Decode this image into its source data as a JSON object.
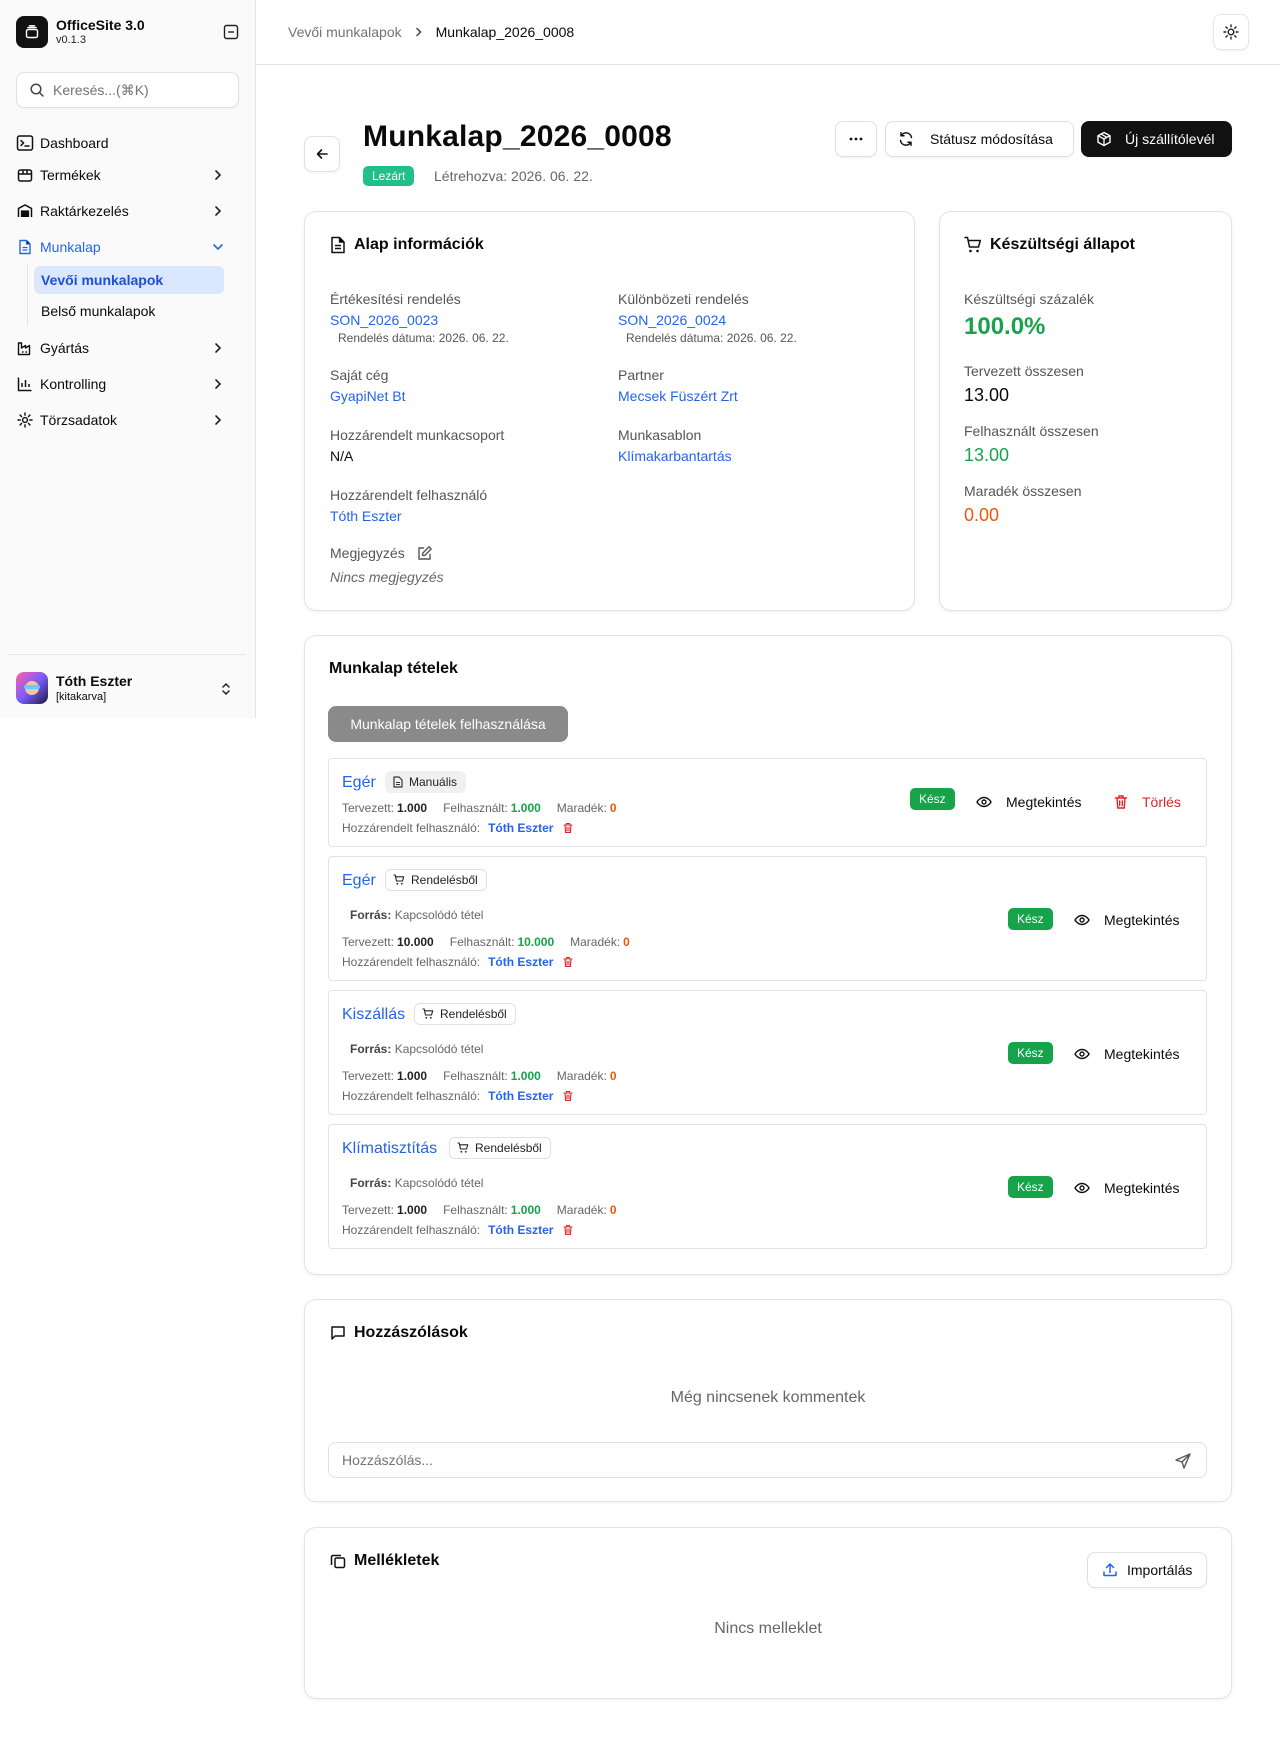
{
  "app": {
    "name": "OfficeSite 3.0",
    "version": "v0.1.3"
  },
  "sidebar": {
    "search_placeholder": "Keresés...(⌘K)",
    "items": [
      {
        "label": "Dashboard"
      },
      {
        "label": "Termékek"
      },
      {
        "label": "Raktárkezelés"
      },
      {
        "label": "Munkalap"
      },
      {
        "label": "Gyártás"
      },
      {
        "label": "Kontrolling"
      },
      {
        "label": "Törzsadatok"
      }
    ],
    "subitems": [
      {
        "label": "Vevői munkalapok",
        "selected": true
      },
      {
        "label": "Belső munkalapok",
        "selected": false
      }
    ],
    "user": {
      "name": "Tóth Eszter",
      "status": "[kitakarva]"
    }
  },
  "breadcrumb": {
    "parent": "Vevői munkalapok",
    "current": "Munkalap_2026_0008"
  },
  "header": {
    "title": "Munkalap_2026_0008",
    "status": "Lezárt",
    "created": "Létrehozva: 2026. 06. 22.",
    "more_label": "···",
    "status_button": "Státusz módosítása",
    "new_button": "Új szállítólevél"
  },
  "basic_info": {
    "title": "Alap információk",
    "sales_order_label": "Értékesítési rendelés",
    "sales_order": "SON_2026_0023",
    "sales_order_date": "Rendelés dátuma: 2026. 06. 22.",
    "diff_order_label": "Különbözeti rendelés",
    "diff_order": "SON_2026_0024",
    "diff_order_date": "Rendelés dátuma: 2026. 06. 22.",
    "own_company_label": "Saját cég",
    "own_company": "GyapiNet Bt",
    "partner_label": "Partner",
    "partner": "Mecsek Füszért Zrt",
    "group_label": "Hozzárendelt munkacsoport",
    "group": "N/A",
    "template_label": "Munkasablon",
    "template": "Klímakarbantartás",
    "user_label": "Hozzárendelt felhasználó",
    "user": "Tóth Eszter",
    "note_label": "Megjegyzés",
    "note": "Nincs megjegyzés"
  },
  "progress": {
    "title": "Készültségi állapot",
    "percent_label": "Készültségi százalék",
    "percent": "100.0%",
    "planned_label": "Tervezett összesen",
    "planned": "13.00",
    "used_label": "Felhasznált összesen",
    "used": "13.00",
    "remaining_label": "Maradék összesen",
    "remaining": "0.00"
  },
  "items_section": {
    "title": "Munkalap tételek",
    "use_button": "Munkalap tételek felhasználása",
    "planned_label": "Tervezett:",
    "used_label": "Felhasznált:",
    "remaining_label": "Maradék:",
    "assigned_label": "Hozzárendelt felhasználó:",
    "source_label": "Forrás:",
    "view_label": "Megtekintés",
    "delete_label": "Törlés",
    "items": [
      {
        "name": "Egér",
        "tag": "Manuális",
        "source": "",
        "planned": "1.000",
        "used": "1.000",
        "remaining": "0",
        "user": "Tóth Eszter",
        "status": "Kész"
      },
      {
        "name": "Egér",
        "tag": "Rendelésből",
        "source": "Kapcsolódó tétel",
        "planned": "10.000",
        "used": "10.000",
        "remaining": "0",
        "user": "Tóth Eszter",
        "status": "Kész"
      },
      {
        "name": "Kiszállás",
        "tag": "Rendelésből",
        "source": "Kapcsolódó tétel",
        "planned": "1.000",
        "used": "1.000",
        "remaining": "0",
        "user": "Tóth Eszter",
        "status": "Kész"
      },
      {
        "name": "Klímatisztítás",
        "tag": "Rendelésből",
        "source": "Kapcsolódó tétel",
        "planned": "1.000",
        "used": "1.000",
        "remaining": "0",
        "user": "Tóth Eszter",
        "status": "Kész"
      }
    ]
  },
  "comments": {
    "title": "Hozzászólások",
    "empty": "Még nincsenek kommentek",
    "placeholder": "Hozzászólás..."
  },
  "attachments": {
    "title": "Mellékletek",
    "import_button": "Importálás",
    "empty": "Nincs melleklet"
  },
  "colors": {
    "accent": "#2563eb",
    "success": "#16a34a",
    "status_badge": "#21c08b",
    "danger": "#dc2626",
    "warning": "#ea580c"
  }
}
